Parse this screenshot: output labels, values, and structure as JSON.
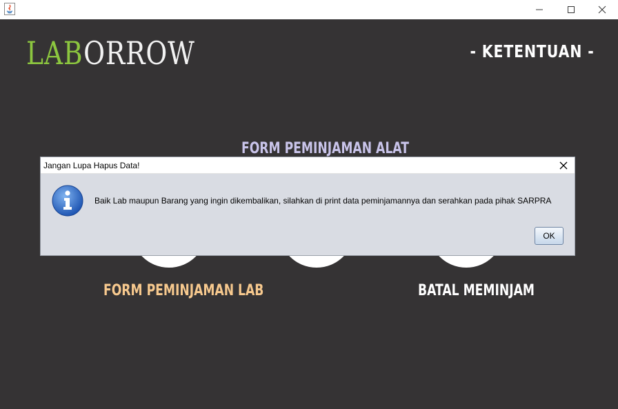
{
  "window": {
    "minimize_icon": "minimize-icon",
    "maximize_icon": "maximize-icon",
    "close_icon": "close-icon"
  },
  "logo": {
    "part1": "LAB",
    "part2": "ORROW",
    "colors": {
      "part1": "#8cc63f",
      "part2": "#f2f2f2"
    }
  },
  "header": {
    "ketentuan": "- KETENTUAN -"
  },
  "menu": {
    "form_alat": "FORM PEMINJAMAN ALAT",
    "form_lab": "FORM PEMINJAMAN LAB",
    "batal": "BATAL MEMINJAM",
    "colors": {
      "form_alat": "#c9c4ea",
      "form_lab": "#f7c98e",
      "batal": "#ffffff"
    }
  },
  "dialog": {
    "title": "Jangan Lupa Hapus Data!",
    "message": "Baik Lab maupun Barang yang ingin dikembalikan, silahkan di print data peminjamannya dan serahkan pada pihak SARPRA",
    "ok_label": "OK",
    "icon": "info-icon"
  }
}
